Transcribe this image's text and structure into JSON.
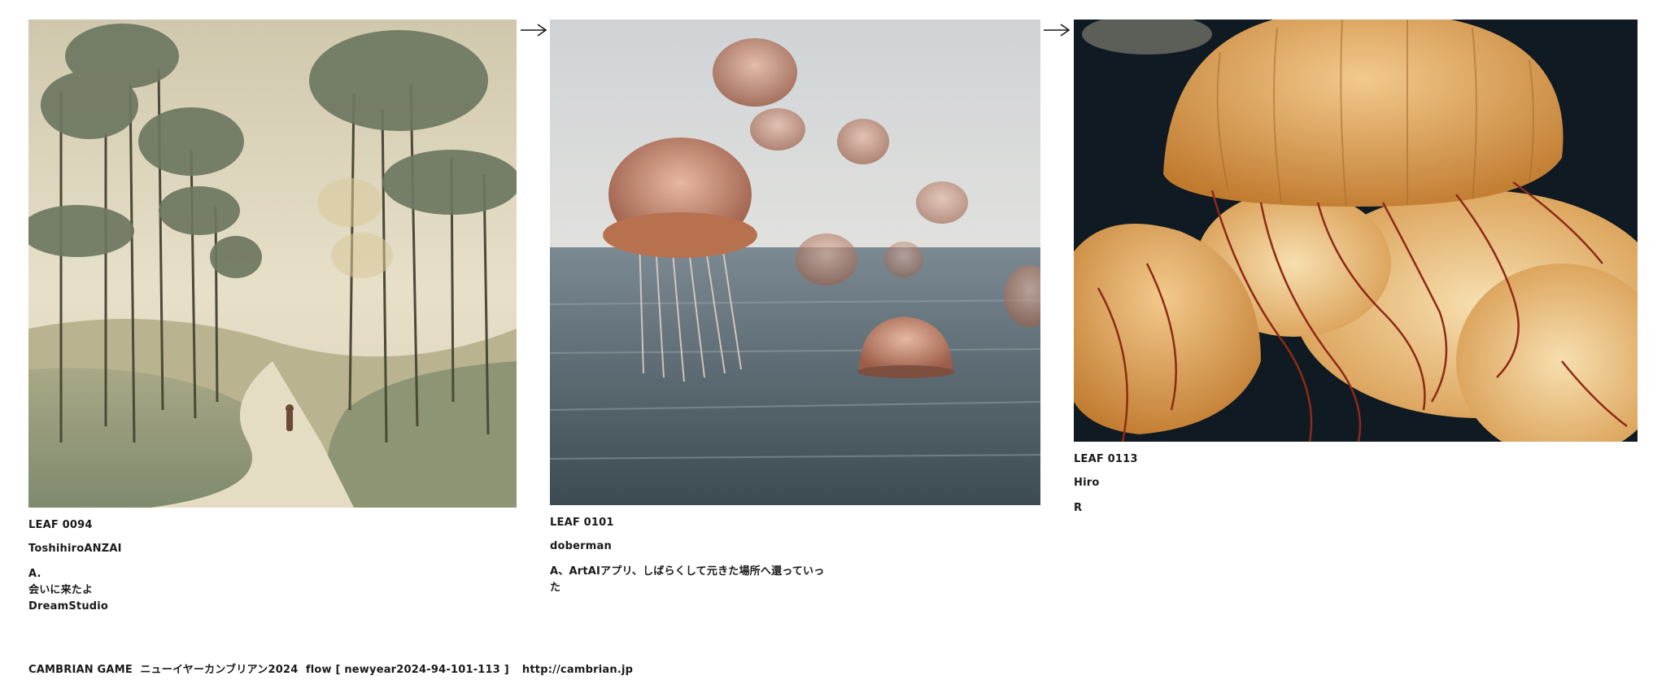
{
  "leaves": [
    {
      "id": "LEAF 0094",
      "author": "ToshihiroANZAI",
      "comment": "A.\n会いに来たよ\nDreamStudio"
    },
    {
      "id": "LEAF 0101",
      "author": "doberman",
      "comment": "A、ArtAIアプリ、しばらくして元きた場所へ還っていっ\nた"
    },
    {
      "id": "LEAF 0113",
      "author": "Hiro",
      "comment": "R"
    }
  ],
  "footer": {
    "title": "CAMBRIAN GAME  ニューイヤーカンブリアン2024  flow [ newyear2024-94-101-113 ]",
    "url": "http://cambrian.jp"
  },
  "icons": {
    "arrow": "right-arrow-icon"
  }
}
